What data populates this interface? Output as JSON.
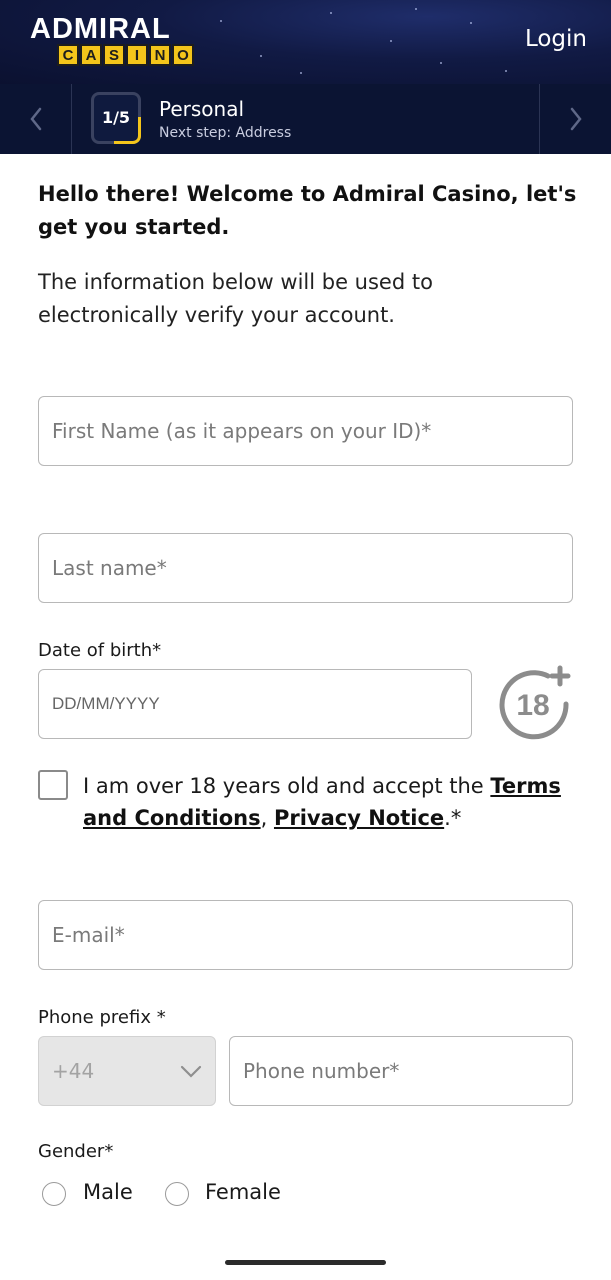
{
  "header": {
    "logo_top": "ADMIRAL",
    "logo_letters": [
      "C",
      "A",
      "S",
      "I",
      "N",
      "O"
    ],
    "login_label": "Login"
  },
  "steps": {
    "current": "1/5",
    "title": "Personal",
    "next": "Next step: Address"
  },
  "intro": {
    "heading": "Hello there! Welcome to Admiral Casino, let's get you started.",
    "text": "The information below will be used to electronically verify your account."
  },
  "form": {
    "first_name_placeholder": "First Name (as it appears on your ID)*",
    "last_name_placeholder": "Last name*",
    "dob_label": "Date of birth*",
    "dob_placeholder": "DD/MM/YYYY",
    "age_badge": "18",
    "terms_prefix": "I am over 18 years old and accept the ",
    "terms_link": "Terms and Conditions",
    "terms_sep": ", ",
    "privacy_link": "Privacy Notice",
    "terms_suffix": ".*",
    "email_placeholder": "E-mail*",
    "phone_prefix_label": "Phone prefix *",
    "phone_prefix_value": "+44",
    "phone_number_placeholder": "Phone number*",
    "gender_label": "Gender*",
    "gender_options": [
      "Male",
      "Female"
    ]
  },
  "colors": {
    "header_bg": "#111a44",
    "stepbar_bg": "#0b1433",
    "brand_yellow": "#f4c51b"
  }
}
